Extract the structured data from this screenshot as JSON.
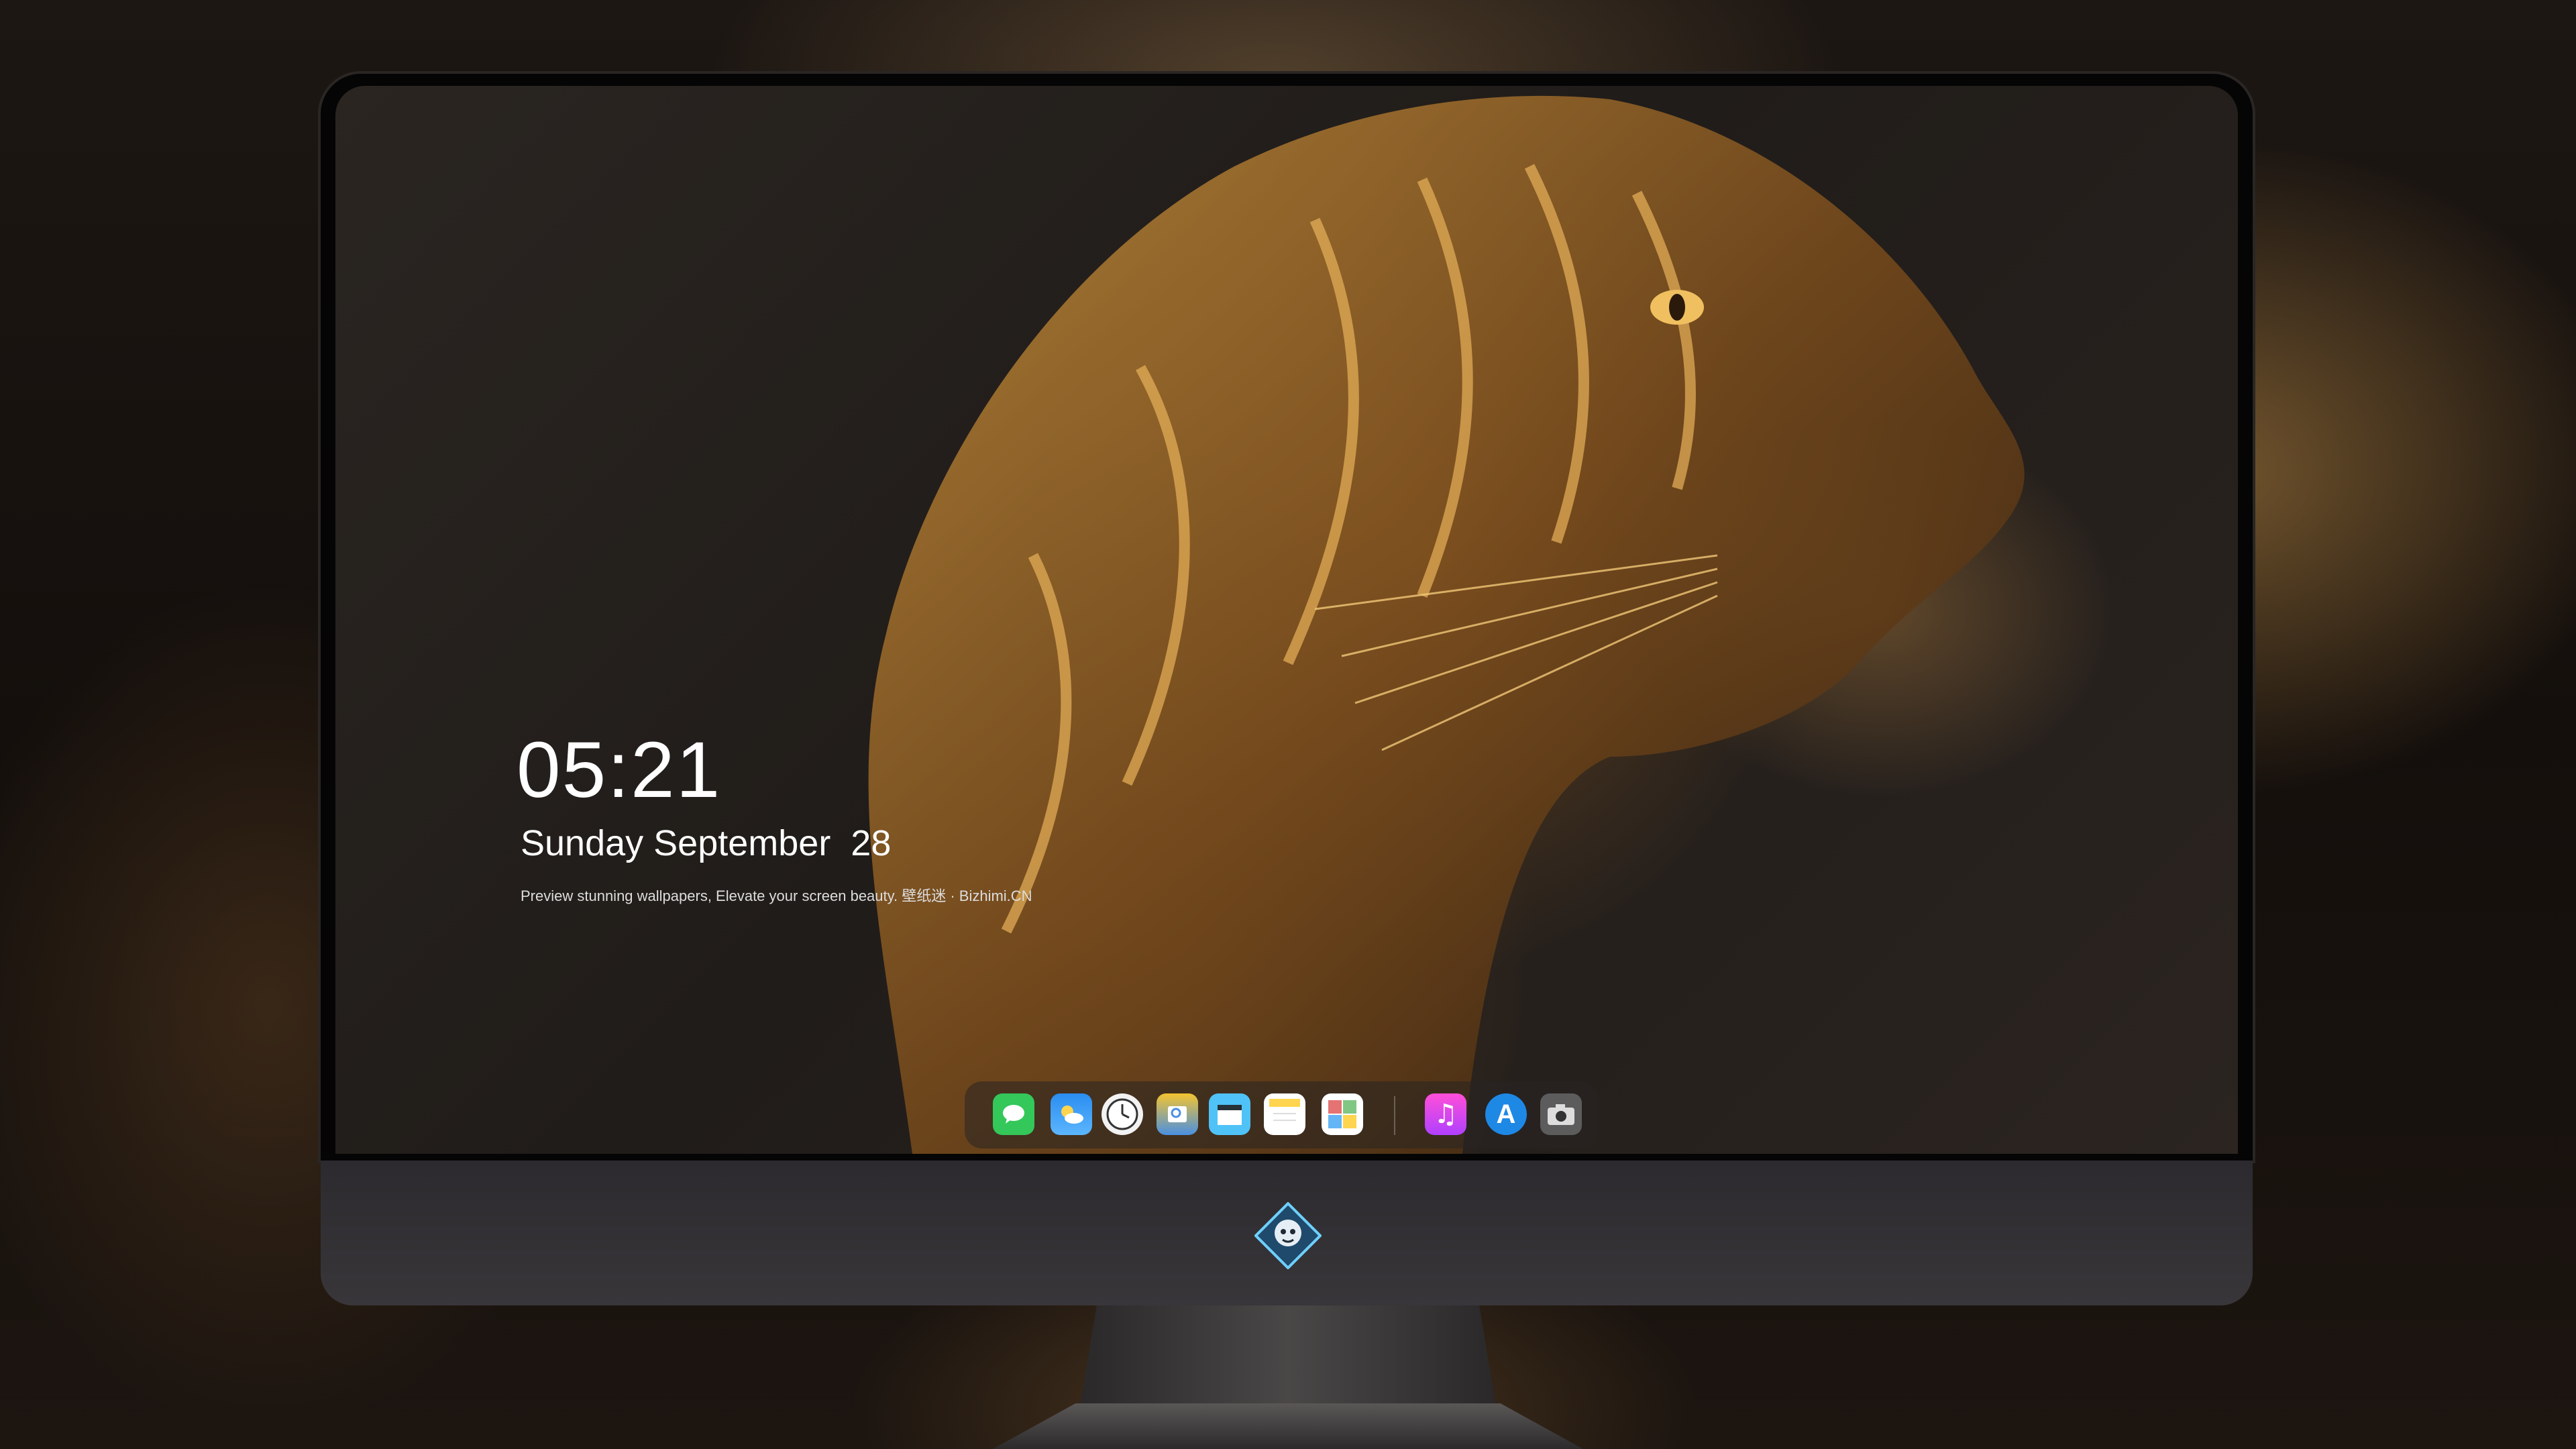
{
  "lockscreen": {
    "time": "05:21",
    "date": "Sunday September  28",
    "tagline": "Preview stunning wallpapers, Elevate your screen beauty. 壁纸迷 · Bizhimi.CN"
  },
  "dock": {
    "apps": [
      {
        "name": "messages-icon",
        "color": "#34c759"
      },
      {
        "name": "weather-icon",
        "color": "#2a8df0"
      },
      {
        "name": "clock-icon",
        "color": "#f2f2f2"
      },
      {
        "name": "preview-icon",
        "color": "#f4c430"
      },
      {
        "name": "clips-icon",
        "color": "#4fc3f7"
      },
      {
        "name": "notes-icon",
        "color": "#ffd54f"
      },
      {
        "name": "photo-booth-icon",
        "color": "#e57373"
      },
      {
        "name": "music-icon",
        "color": "#e040fb"
      },
      {
        "name": "app-store-icon",
        "color": "#1e88e5"
      },
      {
        "name": "camera-icon",
        "color": "#616161"
      }
    ]
  },
  "device": {
    "logo": "tiger-emblem-icon"
  }
}
